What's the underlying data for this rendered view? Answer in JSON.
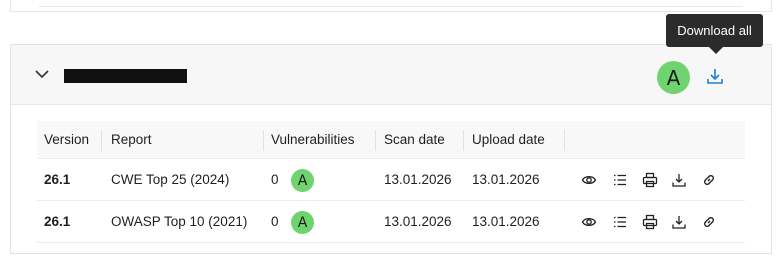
{
  "header": {
    "project_grade": "A",
    "tooltip": "Download all"
  },
  "table": {
    "columns": {
      "version": "Version",
      "report": "Report",
      "vulnerabilities": "Vulnerabilities",
      "scan_date": "Scan date",
      "upload_date": "Upload date"
    },
    "rows": [
      {
        "version": "26.1",
        "report": "CWE Top 25 (2024)",
        "vulnerabilities": "0",
        "grade": "A",
        "scan_date": "13.01.2026",
        "upload_date": "13.01.2026"
      },
      {
        "version": "26.1",
        "report": "OWASP Top 10 (2021)",
        "vulnerabilities": "0",
        "grade": "A",
        "scan_date": "13.01.2026",
        "upload_date": "13.01.2026"
      }
    ]
  },
  "colors": {
    "grade_green": "#6fd46f",
    "accent_blue": "#1e7fd6",
    "tooltip_bg": "#2b2b2b"
  },
  "icons": [
    "chevron-down-icon",
    "download-icon",
    "eye-icon",
    "list-icon",
    "print-icon",
    "download-icon",
    "link-icon"
  ]
}
